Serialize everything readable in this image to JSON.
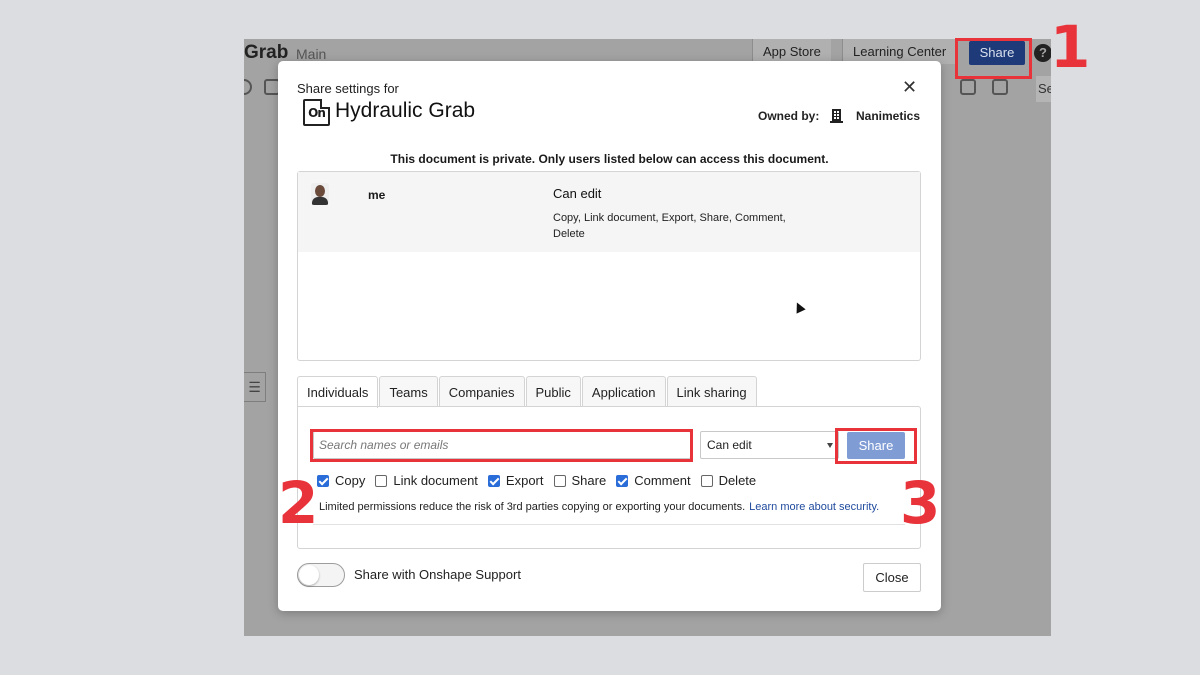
{
  "app": {
    "title": "Grab",
    "branch": "Main",
    "topbar": [
      "App Store",
      "Learning Center"
    ],
    "share_label": "Share",
    "help_icon": "question-circle-icon",
    "toolbar_text": "Se"
  },
  "modal": {
    "subtitle": "Share settings for",
    "doc_icon_text": "On",
    "doc_title": "Hydraulic Grab",
    "owner_label": "Owned by:",
    "owner_name": "Nanimetics",
    "private_note": "This document is private. Only users listed below can access this document.",
    "user": {
      "name": "me",
      "permission": "Can edit",
      "permission_list": "Copy, Link document, Export, Share, Comment, Delete"
    },
    "tabs": [
      "Individuals",
      "Teams",
      "Companies",
      "Public",
      "Application",
      "Link sharing"
    ],
    "active_tab": "Individuals",
    "search_placeholder": "Search names or emails",
    "permission_select": "Can edit",
    "share_button": "Share",
    "checkboxes": [
      {
        "label": "Copy",
        "checked": true
      },
      {
        "label": "Link document",
        "checked": false
      },
      {
        "label": "Export",
        "checked": true
      },
      {
        "label": "Share",
        "checked": false
      },
      {
        "label": "Comment",
        "checked": true
      },
      {
        "label": "Delete",
        "checked": false
      }
    ],
    "limit_note": "Limited permissions reduce the risk of 3rd parties copying or exporting your documents.",
    "limit_link": "Learn more about security.",
    "support_toggle_label": "Share with Onshape Support",
    "support_toggle_on": false,
    "close_button": "Close"
  },
  "annotations": {
    "numbers": [
      "1",
      "2",
      "3"
    ],
    "color": "#e8333a"
  },
  "colors": {
    "accent": "#1e3a78",
    "share_button": "#7f9cd4",
    "link": "#1f4a9e",
    "checkbox": "#2a6dd8"
  }
}
